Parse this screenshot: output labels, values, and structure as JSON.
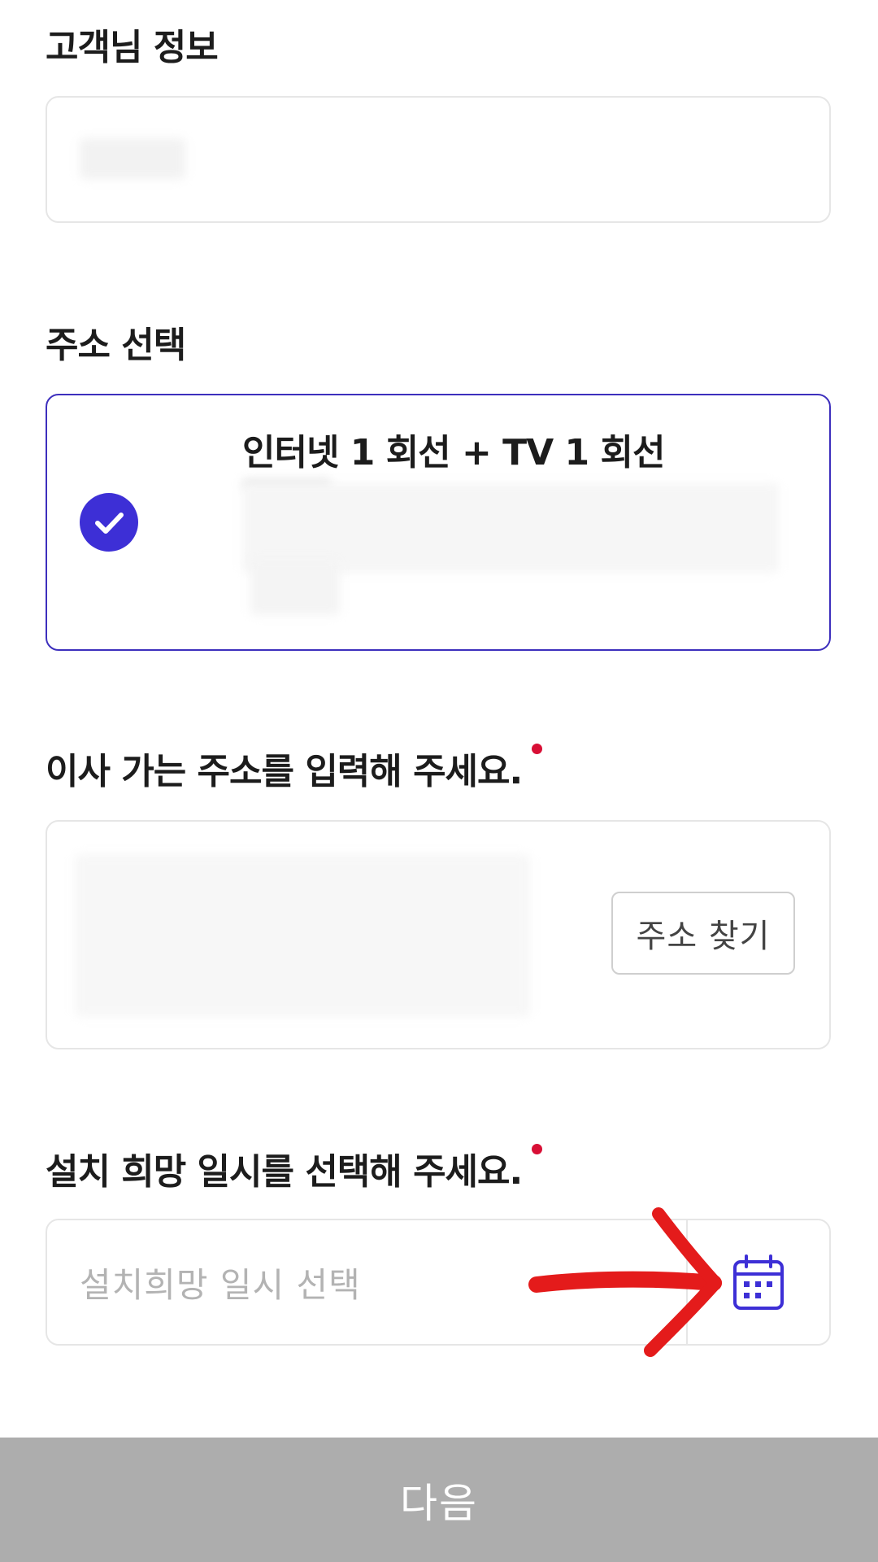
{
  "customer_info": {
    "title": "고객님 정보"
  },
  "address_select": {
    "title": "주소 선택",
    "selected_card": {
      "title": "인터넷 1 회선 + TV 1 회선",
      "checked": true
    }
  },
  "move_address": {
    "title": "이사 가는 주소를 입력해 주세요.",
    "search_button": "주소 찾기"
  },
  "install_date": {
    "title": "설치 희망 일시를 선택해 주세요.",
    "placeholder": "설치희망 일시 선택"
  },
  "footer": {
    "next_label": "다음"
  },
  "colors": {
    "accent": "#3d2fd6",
    "required": "#d80f35",
    "disabled_button": "#adadad",
    "annotation_arrow": "#e41b1b"
  }
}
